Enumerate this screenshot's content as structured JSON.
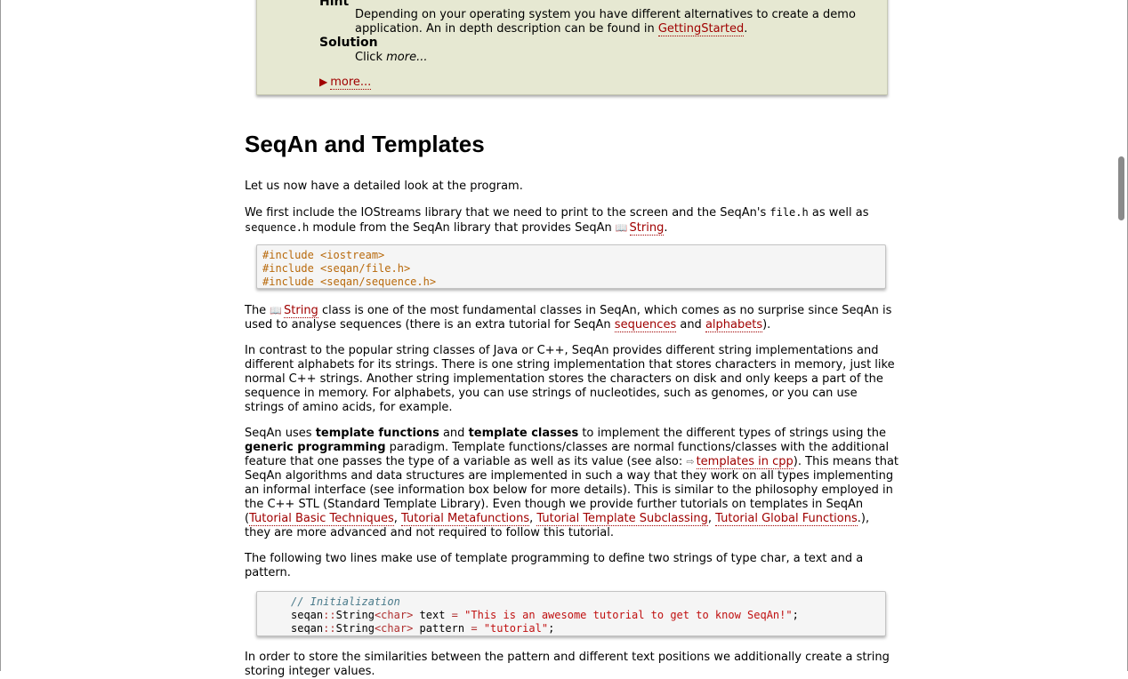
{
  "exercise": {
    "hint_term": "Hint",
    "hint_text": "Depending on your operating system you have different alternatives to create a demo application. An in depth description can be found in ",
    "hint_link": "GettingStarted",
    "hint_tail": ".",
    "solution_term": "Solution",
    "solution_click": "Click ",
    "solution_more": "more...",
    "more_link": "more..."
  },
  "heading": "SeqAn and Templates",
  "p1": "Let us now have a detailed look at the program.",
  "p2": {
    "a": "We first include the IOStreams library that we need to print to the screen and the SeqAn's ",
    "code1": "file.h",
    "b": " as well as ",
    "code2": "sequence.h",
    "c": " module from the SeqAn library that provides SeqAn ",
    "link": "String",
    "d": "."
  },
  "code1": [
    "#include <iostream>",
    "#include <seqan/file.h>",
    "#include <seqan/sequence.h>"
  ],
  "p3": {
    "a": "The ",
    "link1": "String",
    "b": " class is one of the most fundamental classes in SeqAn, which comes as no surprise since SeqAn is used to analyse sequences (there is an extra tutorial for SeqAn ",
    "link2": "sequences",
    "c": " and ",
    "link3": "alphabets",
    "d": ")."
  },
  "p4": "In contrast to the popular string classes of Java or C++, SeqAn provides different string implementations and different alphabets for its strings. There is one string implementation that stores characters in memory, just like normal C++ strings. Another string implementation stores the characters on disk and only keeps a part of the sequence in memory. For alphabets, you can use strings of nucleotides, such as genomes, or you can use strings of amino acids, for example.",
  "p5": {
    "a": "SeqAn uses ",
    "b1": "template functions",
    "b": " and ",
    "b2": "template classes",
    "c": " to implement the different types of strings using the ",
    "b3": "generic programming",
    "d": " paradigm. Template functions/classes are normal functions/classes with the additional feature that one passes the type of a variable as well as its value (see also: ",
    "link_cpp": "templates in cpp",
    "e": "). This means that SeqAn algorithms and data structures are implemented in such a way that they work on all types implementing an informal interface (see information box below for more details). This is similar to the philosophy employed in the C++ STL (Standard Template Library). Even though we provide further tutorials on templates in SeqAn (",
    "t1": "Tutorial Basic Techniques",
    "s1": ", ",
    "t2": "Tutorial Metafunctions",
    "s2": ", ",
    "t3": "Tutorial Template Subclassing",
    "s3": ", ",
    "t4": "Tutorial Global Functions",
    "f": ".), they are more advanced and not required to follow this tutorial."
  },
  "p6": "The following two lines make use of template programming to define two strings of type char, a text and a pattern.",
  "code2": {
    "comment": "// Initialization",
    "l1_a": "seqan",
    "l1_b": "String",
    "l1_type": "char",
    "l1_var": " text ",
    "l1_str": "\"This is an awesome tutorial to get to know SeqAn!\"",
    "l2_var": " pattern ",
    "l2_str": "\"tutorial\""
  },
  "p7": "In order to store the similarities between the pattern and different text positions we additionally create a string storing integer values."
}
